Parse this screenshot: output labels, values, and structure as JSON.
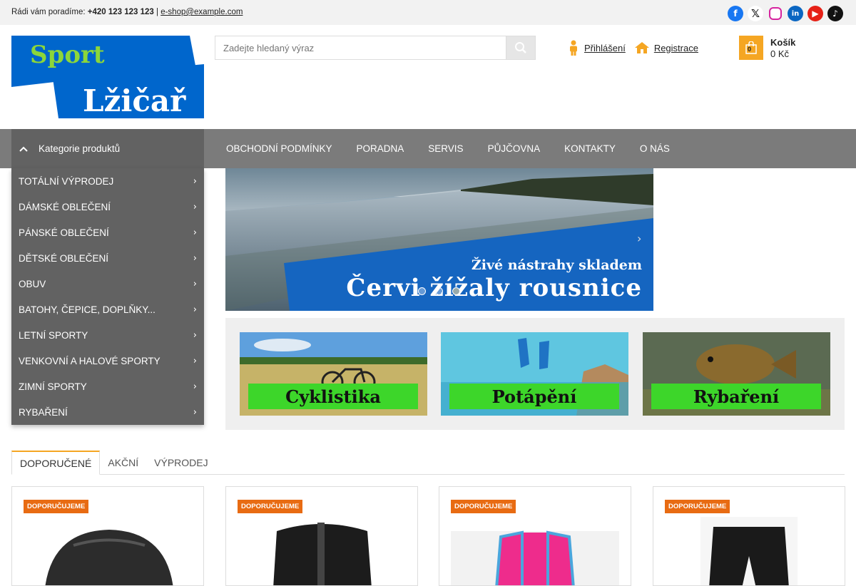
{
  "topbar": {
    "intro": "Rádi vám poradíme:",
    "phone": "+420 123 123 123",
    "separator": " | ",
    "email": "e-shop@example.com",
    "socials": [
      "facebook-icon",
      "x-icon",
      "instagram-icon",
      "linkedin-icon",
      "youtube-icon",
      "tiktok-icon"
    ]
  },
  "logo": {
    "line1": "Sport",
    "line2": "Lžičař",
    "colors": {
      "blue": "#0066cc",
      "green": "#8cd63a"
    }
  },
  "search": {
    "placeholder": "Zadejte hledaný výraz"
  },
  "user": {
    "login": "Přihlášení",
    "register": "Registrace"
  },
  "cart": {
    "title": "Košík",
    "total": "0 Kč",
    "count": "0"
  },
  "nav": {
    "categories_label": "Kategorie produktů",
    "items": [
      "OBCHODNÍ PODMÍNKY",
      "PORADNA",
      "SERVIS",
      "PŮJČOVNA",
      "KONTAKTY",
      "O NÁS"
    ]
  },
  "categories": [
    "TOTÁLNÍ VÝPRODEJ",
    "DÁMSKÉ OBLEČENÍ",
    "PÁNSKÉ OBLEČENÍ",
    "DĚTSKÉ OBLEČENÍ",
    "OBUV",
    "BATOHY, ČEPICE, DOPLŇKY...",
    "LETNÍ SPORTY",
    "VENKOVNÍ A HALOVÉ SPORTY",
    "ZIMNÍ SPORTY",
    "RYBAŘENÍ"
  ],
  "banner": {
    "line1": "Živé nástrahy skladem",
    "line2": "Červi  žížaly  rousnice",
    "slides": 3,
    "active_slide": 3
  },
  "tiles": [
    "Cyklistika",
    "Potápění",
    "Rybaření"
  ],
  "tabs": [
    "DOPORUČENÉ",
    "AKČNÍ",
    "VÝPRODEJ"
  ],
  "products": [
    {
      "badge": "DOPORUČUJEME"
    },
    {
      "badge": "DOPORUČUJEME"
    },
    {
      "badge": "DOPORUČUJEME"
    },
    {
      "badge": "DOPORUČUJEME"
    }
  ],
  "colors": {
    "accent": "#f5a623",
    "badge": "#e86b12",
    "nav": "#7b7b7b",
    "sidebar": "#626262",
    "tile_label": "#3dd62a"
  }
}
